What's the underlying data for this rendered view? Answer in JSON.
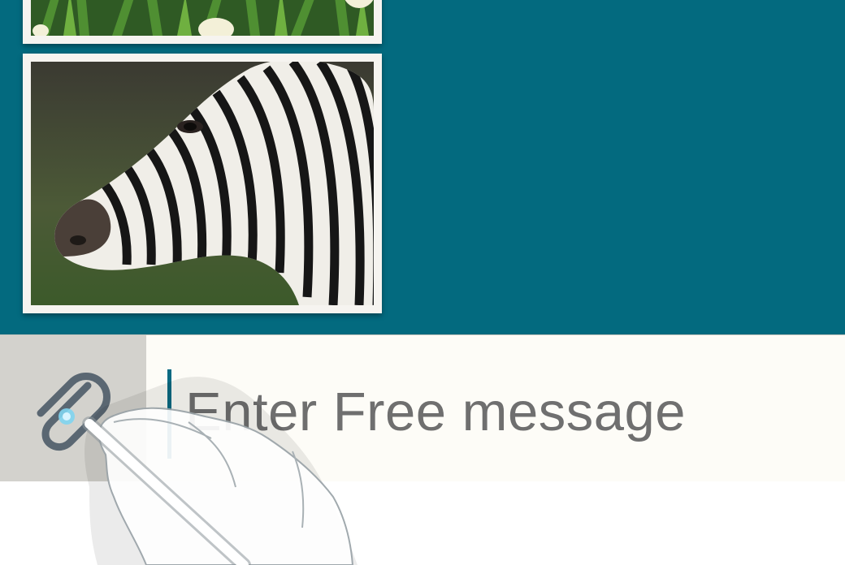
{
  "colors": {
    "background": "#036a7f",
    "composer_background": "#fdfcf7",
    "attach_background": "#d3d2cd",
    "cursor": "#0b6a82",
    "placeholder_text": "#6f6f6f"
  },
  "gallery": {
    "images": [
      {
        "name": "tulips",
        "description_icon": "tulips-photo"
      },
      {
        "name": "zebra",
        "description_icon": "zebra-photo"
      }
    ]
  },
  "composer": {
    "attach_icon": "paperclip-icon",
    "placeholder": "Enter Free message"
  }
}
